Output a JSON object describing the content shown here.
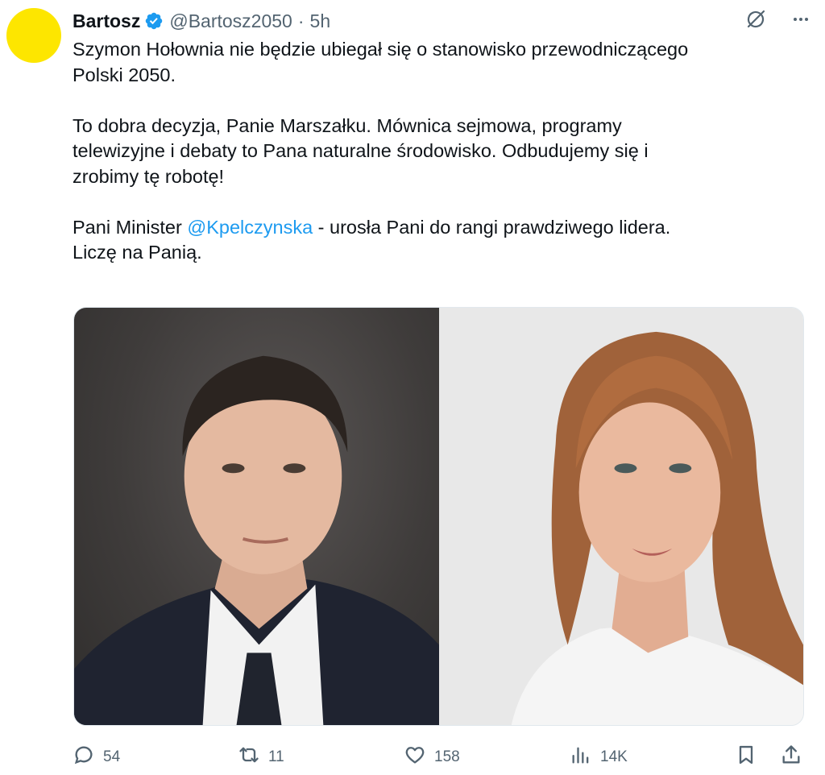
{
  "author": {
    "name": "Bartosz",
    "handle": "@Bartosz2050",
    "separator": "·",
    "time": "5h",
    "avatar_color": "#fde600",
    "verified": true
  },
  "tweet": {
    "para1": "Szymon Hołownia nie będzie ubiegał się o stanowisko przewodniczącego\nPolski 2050.",
    "para2": "To dobra decyzja, Panie Marszałku. Mównica sejmowa, programy\ntelewizyjne i debaty to Pana naturalne środowisko. Odbudujemy się i\nzrobimy tę robotę!",
    "para3_before": "Pani Minister ",
    "para3_mention": "@Kpelczynska",
    "para3_after": " - urosła Pani do rangi prawdziwego lidera.\nLiczę na Panią."
  },
  "media": {
    "left_photo": "man-portrait-photo",
    "right_photo": "woman-portrait-photo"
  },
  "actions": {
    "reply_count": "54",
    "repost_count": "11",
    "like_count": "158",
    "views_count": "14K"
  },
  "icons": {
    "top": [
      "grok-icon",
      "more-icon"
    ],
    "bottom": [
      "reply-icon",
      "repost-icon",
      "like-icon",
      "views-icon",
      "bookmark-icon",
      "share-icon"
    ]
  },
  "colors": {
    "text": "#0f1419",
    "secondary": "#536471",
    "link": "#1d9bf0",
    "verified": "#1d9bf0"
  }
}
